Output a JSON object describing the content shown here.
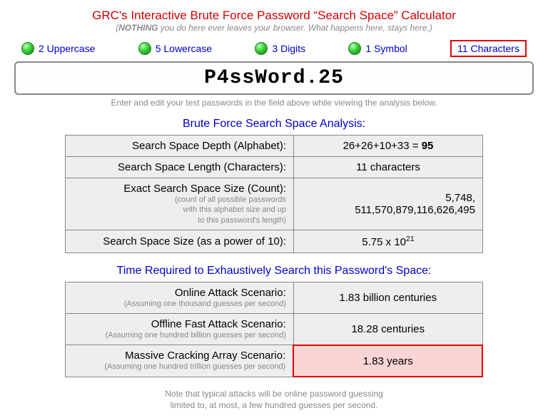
{
  "title": "GRC's Interactive Brute Force Password “Search Space” Calculator",
  "subtitle_nothing": "NOTHING",
  "subtitle_rest": " you do here ever leaves your browser. What happens here, stays here.)",
  "stats": {
    "uppercase": "2 Uppercase",
    "lowercase": "5 Lowercase",
    "digits": "3 Digits",
    "symbol": "1 Symbol",
    "characters": "11 Characters"
  },
  "password": "P4ssWord.25",
  "hint": "Enter and edit your test passwords in the field above while viewing the analysis below.",
  "analysis_title": "Brute Force Search Space Analysis:",
  "rows": {
    "depth_label": "Search Space Depth (Alphabet):",
    "depth_value_prefix": "26+26+10+33 = ",
    "depth_value_bold": "95",
    "length_label": "Search Space Length (Characters):",
    "length_value": "11 characters",
    "count_label": "Exact Search Space Size (Count):",
    "count_sub1": "(count of all possible passwords",
    "count_sub2": "with this alphabet size and up",
    "count_sub3": "to this password's length)",
    "count_value_l1": "5,748,",
    "count_value_l2": "511,570,879,116,626,495",
    "power_label": "Search Space Size (as a power of 10):",
    "power_value_base": "5.75 x 10",
    "power_value_exp": "21"
  },
  "time_title": "Time Required to Exhaustively Search this Password's Space:",
  "time_rows": {
    "online_label": "Online Attack Scenario:",
    "online_sub": "(Assuming one thousand guesses per second)",
    "online_value": "1.83 billion centuries",
    "offline_label": "Offline Fast Attack Scenario:",
    "offline_sub": "(Assuming one hundred billion guesses per second)",
    "offline_value": "18.28 centuries",
    "massive_label": "Massive Cracking Array Scenario:",
    "massive_sub": "(Assuming one hundred trillion guesses per second)",
    "massive_value": "1.83 years"
  },
  "footnote_l1": "Note that typical attacks will be online password guessing",
  "footnote_l2": "limited to, at most, a few hundred guesses per second."
}
